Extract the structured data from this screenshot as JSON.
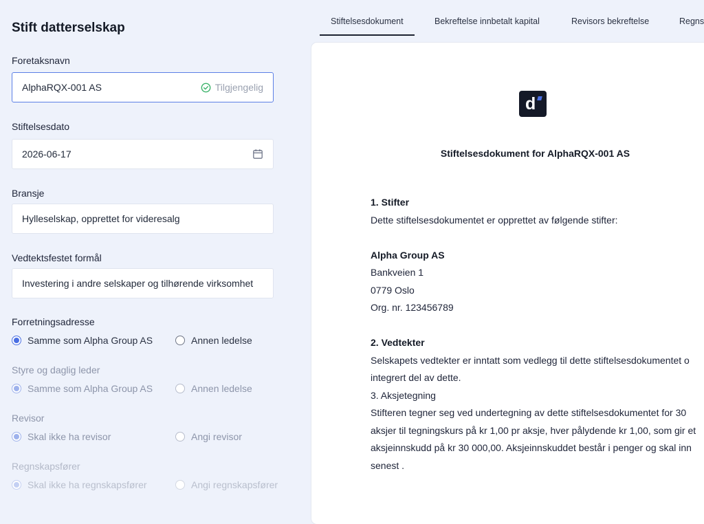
{
  "form": {
    "title": "Stift datterselskap",
    "company_name": {
      "label": "Foretaksnavn",
      "value": "AlphaRQX-001 AS",
      "status": "Tilgjengelig",
      "status_icon": "check-circle-icon",
      "status_color": "#3db36b"
    },
    "founding_date": {
      "label": "Stiftelsesdato",
      "value": "2026-06-17",
      "icon": "calendar-icon"
    },
    "industry": {
      "label": "Bransje",
      "value": "Hylleselskap, opprettet for videresalg"
    },
    "purpose": {
      "label": "Vedtektsfestet formål",
      "value": "Investering i andre selskaper og tilhørende virksomhet"
    },
    "business_address": {
      "label": "Forretningsadresse",
      "option1": "Samme som Alpha Group AS",
      "option2": "Annen ledelse",
      "selected": "option1"
    },
    "board": {
      "label": "Styre og daglig leder",
      "option1": "Samme som Alpha Group AS",
      "option2": "Annen ledelse",
      "selected": "option1"
    },
    "auditor": {
      "label": "Revisor",
      "option1": "Skal ikke ha revisor",
      "option2": "Angi revisor",
      "selected": "option1"
    },
    "accountant": {
      "label": "Regnskapsfører",
      "option1": "Skal ikke ha regnskapsfører",
      "option2": "Angi regnskapsfører",
      "selected": "option1"
    }
  },
  "tabs": [
    {
      "label": "Stiftelsesdokument",
      "active": true
    },
    {
      "label": "Bekreftelse innbetalt kapital",
      "active": false
    },
    {
      "label": "Revisors bekreftelse",
      "active": false
    },
    {
      "label": "Regns",
      "active": false
    }
  ],
  "document": {
    "logo_letter": "d",
    "title": "Stiftelsesdokument for AlphaRQX-001 AS",
    "section1_heading": "1. Stifter",
    "section1_text": "Dette stiftelsesdokumentet er opprettet av følgende stifter:",
    "founder_name": "Alpha Group AS",
    "founder_street": "Bankveien 1",
    "founder_city": "0779 Oslo",
    "founder_org": "Org. nr. 123456789",
    "section2_heading": "2. Vedtekter",
    "section2_line1": "Selskapets vedtekter er inntatt som vedlegg til dette stiftelsesdokumentet o",
    "section2_line2": "integrert del av dette.",
    "section3_heading": "3. Aksjetegning",
    "section3_line1": "Stifteren tegner seg ved undertegning av dette stiftelsesdokumentet for 30",
    "section3_line2": "aksjer til tegningskurs på kr 1,00 pr aksje, hver pålydende kr 1,00, som gir et",
    "section3_line3": "aksjeinnskudd på kr 30 000,00. Aksjeinnskuddet består i penger og skal inn",
    "section3_line4": "senest ."
  }
}
